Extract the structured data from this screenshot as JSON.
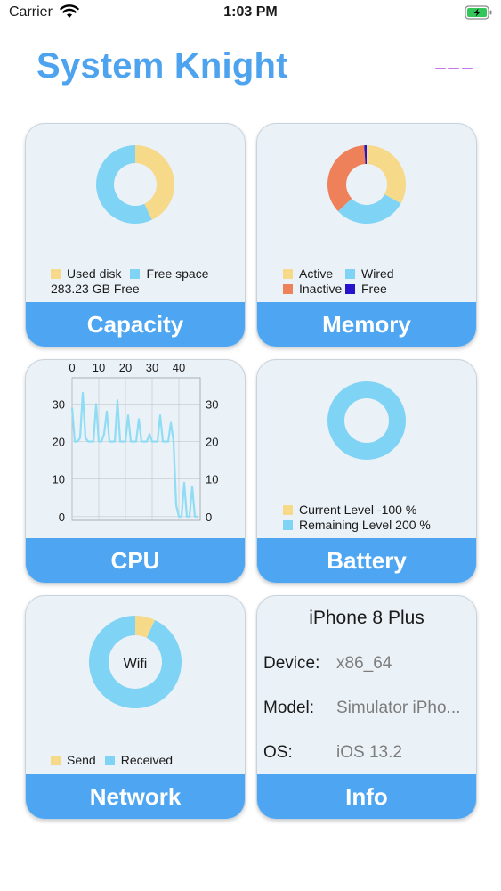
{
  "status_bar": {
    "carrier": "Carrier",
    "time": "1:03 PM",
    "wifi_icon": "wifi-icon",
    "battery_icon": "battery-charging-icon"
  },
  "app": {
    "title": "System Knight",
    "menu_icon": "dashed-menu-icon"
  },
  "colors": {
    "accent": "#4ea6f2",
    "title": "#4da3ee",
    "yellow": "#f7d98a",
    "light_blue": "#7fd3f5",
    "orange": "#ee8159",
    "indigo": "#2713c9",
    "menu": "#c376e8"
  },
  "capacity": {
    "label": "Capacity",
    "legend": [
      "Used disk",
      "Free space"
    ],
    "free_text": "283.23 GB Free",
    "chart_data": {
      "type": "pie",
      "donut": true,
      "categories": [
        "Used disk",
        "Free space"
      ],
      "values": [
        43,
        57
      ]
    }
  },
  "memory": {
    "label": "Memory",
    "legend": [
      "Active",
      "Wired",
      "Inactive",
      "Free"
    ],
    "chart_data": {
      "type": "pie",
      "donut": true,
      "categories": [
        "Active",
        "Wired",
        "Inactive",
        "Free"
      ],
      "values": [
        33,
        30,
        36,
        1
      ]
    }
  },
  "cpu": {
    "label": "CPU",
    "chart_data": {
      "type": "line",
      "x_ticks": [
        0,
        10,
        20,
        30,
        40
      ],
      "y_ticks": [
        0,
        10,
        20,
        30
      ],
      "xlim": [
        0,
        48
      ],
      "ylim": [
        -1,
        37
      ],
      "grid": true,
      "series": [
        {
          "values": [
            29,
            20,
            20,
            21,
            33,
            21,
            20,
            20,
            20,
            30,
            20,
            20,
            22,
            28,
            20,
            20,
            20,
            31,
            20,
            20,
            20,
            27,
            20,
            20,
            20,
            26,
            20,
            20,
            20,
            22,
            20,
            20,
            20,
            27,
            20,
            20,
            20,
            25,
            20,
            3,
            0,
            0,
            9,
            0,
            0,
            8,
            0,
            0
          ]
        }
      ]
    }
  },
  "battery": {
    "label": "Battery",
    "legend": [
      "Current Level -100 %",
      "Remaining Level 200 %"
    ],
    "chart_data": {
      "type": "pie",
      "donut": true,
      "categories": [
        "Current Level",
        "Remaining Level"
      ],
      "values": [
        -100,
        200
      ]
    }
  },
  "network": {
    "label": "Network",
    "center_label": "Wifi",
    "legend": [
      "Send",
      "Received"
    ],
    "chart_data": {
      "type": "pie",
      "donut": true,
      "categories": [
        "Send",
        "Received"
      ],
      "values": [
        7,
        93
      ]
    }
  },
  "info": {
    "label": "Info",
    "device_name": "iPhone 8 Plus",
    "rows": [
      {
        "key": "Device:",
        "value": "x86_64"
      },
      {
        "key": "Model:",
        "value": "Simulator iPho..."
      },
      {
        "key": "OS:",
        "value": "iOS 13.2"
      }
    ]
  }
}
